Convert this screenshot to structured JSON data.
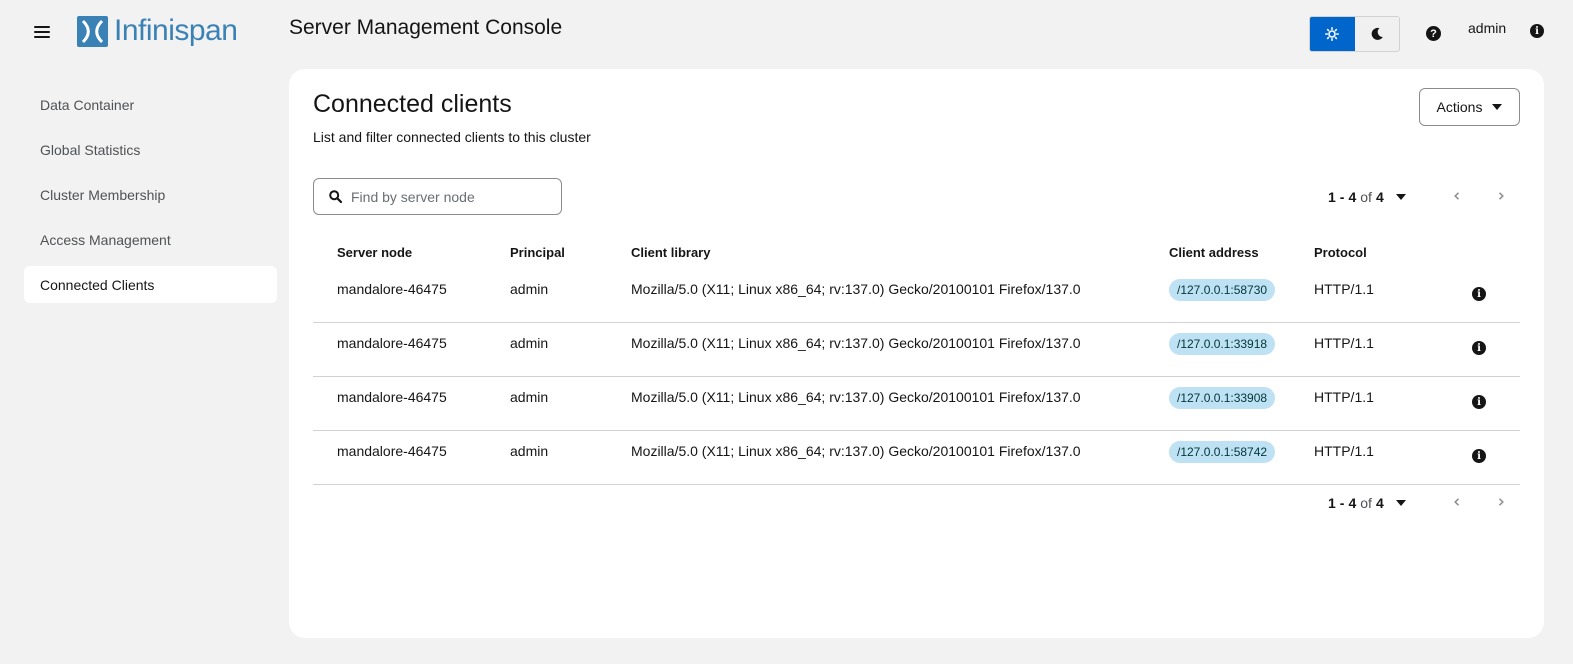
{
  "header": {
    "logo_text": "Infinispan",
    "app_title": "Server Management Console",
    "user": "admin",
    "help_glyph": "?",
    "info_glyph": "i",
    "theme": {
      "light_icon": "sun-icon",
      "dark_icon": "moon-icon",
      "active": "light",
      "accent": "#0066cc"
    }
  },
  "sidebar": {
    "items": [
      {
        "label": "Data Container",
        "active": false
      },
      {
        "label": "Global Statistics",
        "active": false
      },
      {
        "label": "Cluster Membership",
        "active": false
      },
      {
        "label": "Access Management",
        "active": false
      },
      {
        "label": "Connected Clients",
        "active": true
      }
    ]
  },
  "main": {
    "title": "Connected clients",
    "description": "List and filter connected clients to this cluster",
    "actions_label": "Actions",
    "search": {
      "placeholder": "Find by server node",
      "value": ""
    },
    "pagination": {
      "start": "1",
      "end": "4",
      "dash": "-",
      "of": "of",
      "total": "4"
    },
    "table": {
      "columns": [
        "Server node",
        "Principal",
        "Client library",
        "Client address",
        "Protocol"
      ],
      "rows": [
        {
          "server_node": "mandalore-46475",
          "principal": "admin",
          "client_library": "Mozilla/5.0 (X11; Linux x86_64; rv:137.0) Gecko/20100101 Firefox/137.0",
          "client_address": "/127.0.0.1:58730",
          "protocol": "HTTP/1.1"
        },
        {
          "server_node": "mandalore-46475",
          "principal": "admin",
          "client_library": "Mozilla/5.0 (X11; Linux x86_64; rv:137.0) Gecko/20100101 Firefox/137.0",
          "client_address": "/127.0.0.1:33918",
          "protocol": "HTTP/1.1"
        },
        {
          "server_node": "mandalore-46475",
          "principal": "admin",
          "client_library": "Mozilla/5.0 (X11; Linux x86_64; rv:137.0) Gecko/20100101 Firefox/137.0",
          "client_address": "/127.0.0.1:33908",
          "protocol": "HTTP/1.1"
        },
        {
          "server_node": "mandalore-46475",
          "principal": "admin",
          "client_library": "Mozilla/5.0 (X11; Linux x86_64; rv:137.0) Gecko/20100101 Firefox/137.0",
          "client_address": "/127.0.0.1:58742",
          "protocol": "HTTP/1.1"
        }
      ]
    }
  }
}
